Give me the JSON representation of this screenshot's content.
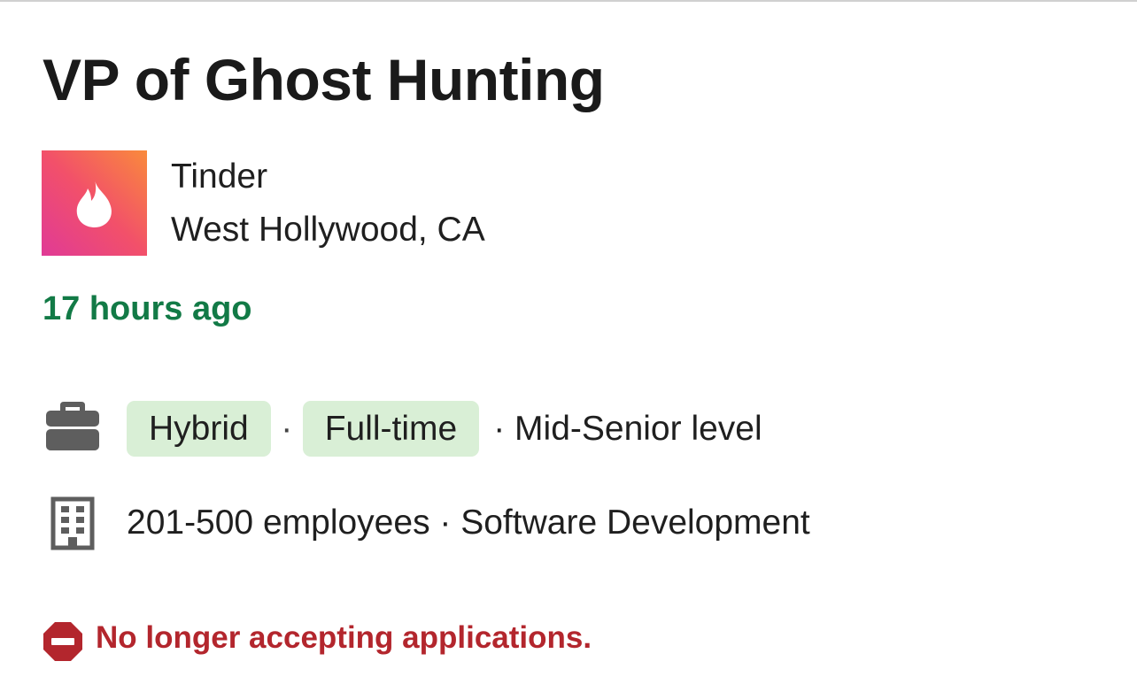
{
  "job": {
    "title": "VP of Ghost Hunting",
    "company": {
      "name": "Tinder",
      "location": "West Hollywood, CA",
      "logo_icon": "flame-logo-icon"
    },
    "posted": "17 hours ago",
    "workplace_type": "Hybrid",
    "employment_type": "Full-time",
    "separator": "·",
    "level_text": "· Mid-Senior level",
    "company_info": "201-500 employees · Software Development",
    "status": "No longer accepting applications."
  },
  "icons": {
    "job_type": "briefcase-icon",
    "company": "building-icon",
    "status": "stop-icon"
  },
  "colors": {
    "posted": "#127a46",
    "pill_bg": "#d9efd6",
    "status": "#b3262d",
    "logo_gradient_start": "#e03a96",
    "logo_gradient_end": "#f98a3c",
    "icon_gray": "#5e5e5e"
  }
}
